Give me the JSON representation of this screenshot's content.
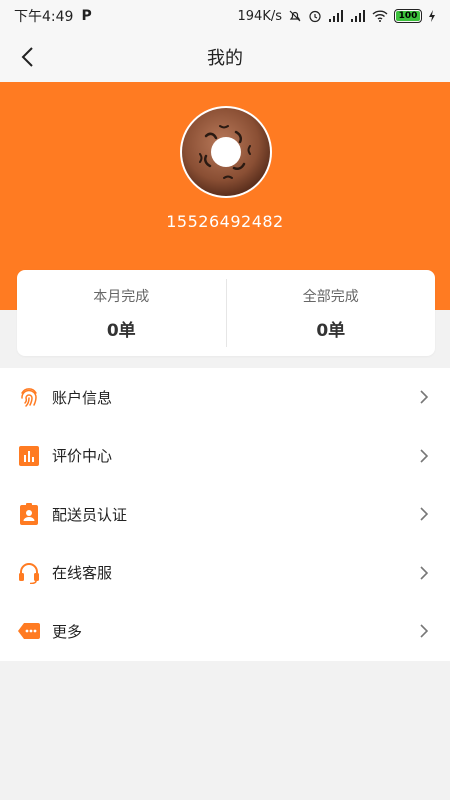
{
  "status_bar": {
    "time": "下午4:49",
    "app_indicator": "P",
    "network_speed": "194K/s",
    "battery_level": "100",
    "icons": [
      "mute-icon",
      "alarm-icon",
      "signal-icon",
      "signal-icon",
      "wifi-icon",
      "battery-icon",
      "charging-icon"
    ]
  },
  "nav": {
    "title": "我的",
    "back_icon": "chevron-left-icon"
  },
  "profile": {
    "avatar_icon": "avatar-image",
    "phone": "15526492482"
  },
  "stats": {
    "month": {
      "label": "本月完成",
      "value": "0单"
    },
    "total": {
      "label": "全部完成",
      "value": "0单"
    }
  },
  "menu": {
    "items": [
      {
        "label": "账户信息",
        "icon": "fingerprint-icon"
      },
      {
        "label": "评价中心",
        "icon": "bar-chart-icon"
      },
      {
        "label": "配送员认证",
        "icon": "badge-icon"
      },
      {
        "label": "在线客服",
        "icon": "headset-icon"
      },
      {
        "label": "更多",
        "icon": "more-tag-icon"
      }
    ]
  },
  "colors": {
    "accent": "#ff7b22",
    "background": "#f2f2f2"
  }
}
